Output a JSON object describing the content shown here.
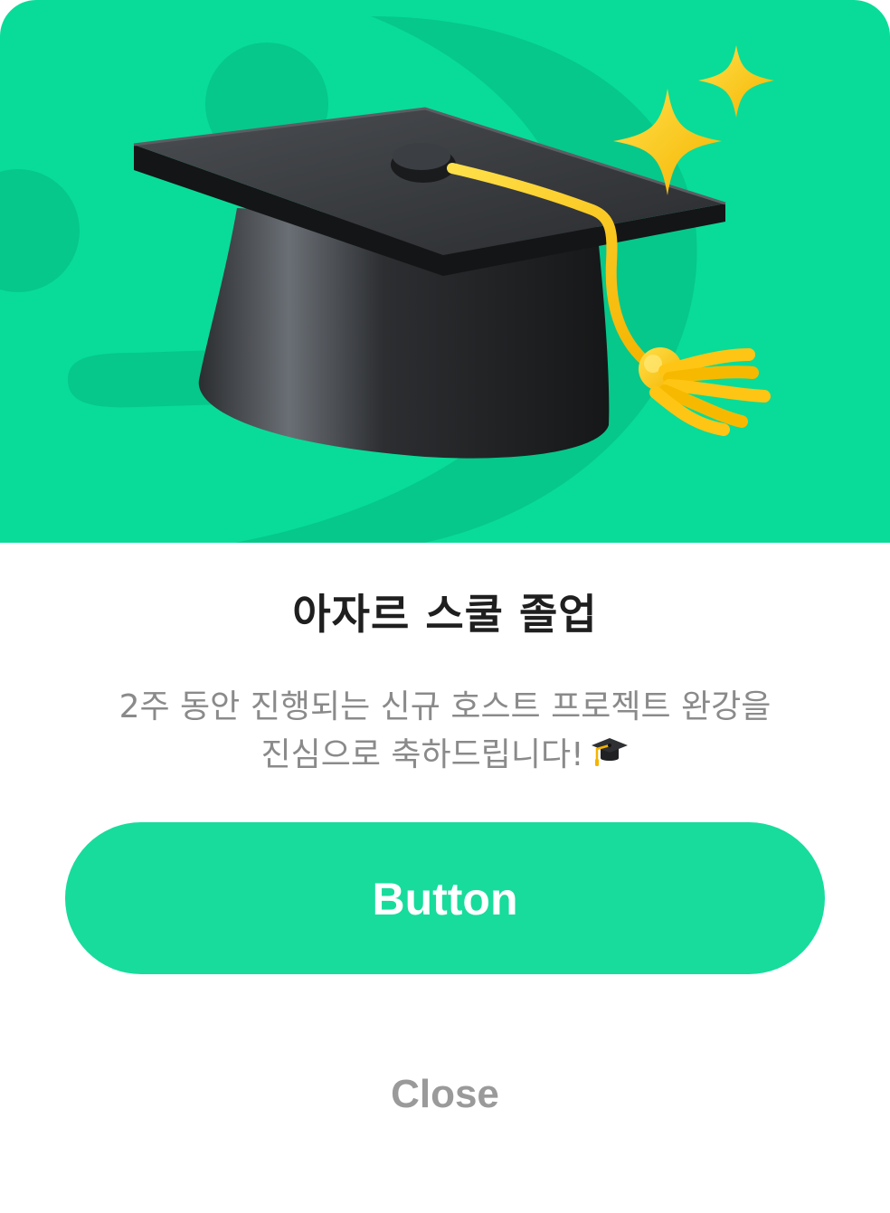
{
  "hero": {
    "illustration_icon": "graduation-cap-icon",
    "sparkle_icon": "sparkle-icon",
    "background_color": "#08DC98",
    "accent_color": "#FFC515"
  },
  "dialog": {
    "title": "아자르 스쿨 졸업",
    "description_line1": "2주 동안 진행되는 신규 호스트 프로젝트 완강을",
    "description_line2": "진심으로 축하드립니다!",
    "description_emoji": "graduation-cap-icon"
  },
  "actions": {
    "primary_label": "Button",
    "primary_color": "#17DC9C",
    "close_label": "Close"
  }
}
